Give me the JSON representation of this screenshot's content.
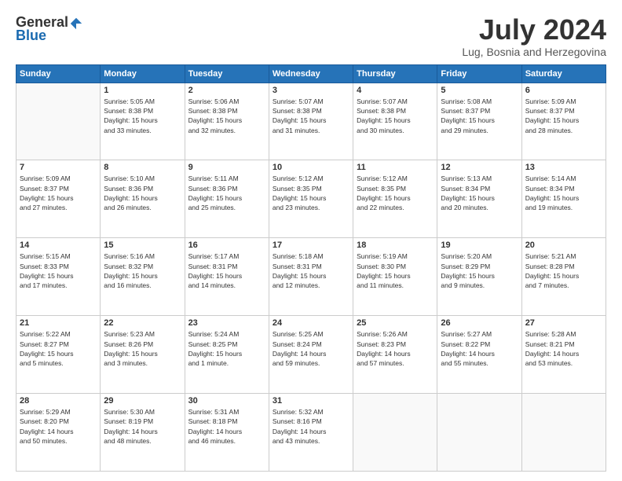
{
  "logo": {
    "general": "General",
    "blue": "Blue"
  },
  "title": "July 2024",
  "subtitle": "Lug, Bosnia and Herzegovina",
  "days_header": [
    "Sunday",
    "Monday",
    "Tuesday",
    "Wednesday",
    "Thursday",
    "Friday",
    "Saturday"
  ],
  "weeks": [
    [
      {
        "num": "",
        "info": ""
      },
      {
        "num": "1",
        "info": "Sunrise: 5:05 AM\nSunset: 8:38 PM\nDaylight: 15 hours\nand 33 minutes."
      },
      {
        "num": "2",
        "info": "Sunrise: 5:06 AM\nSunset: 8:38 PM\nDaylight: 15 hours\nand 32 minutes."
      },
      {
        "num": "3",
        "info": "Sunrise: 5:07 AM\nSunset: 8:38 PM\nDaylight: 15 hours\nand 31 minutes."
      },
      {
        "num": "4",
        "info": "Sunrise: 5:07 AM\nSunset: 8:38 PM\nDaylight: 15 hours\nand 30 minutes."
      },
      {
        "num": "5",
        "info": "Sunrise: 5:08 AM\nSunset: 8:37 PM\nDaylight: 15 hours\nand 29 minutes."
      },
      {
        "num": "6",
        "info": "Sunrise: 5:09 AM\nSunset: 8:37 PM\nDaylight: 15 hours\nand 28 minutes."
      }
    ],
    [
      {
        "num": "7",
        "info": "Sunrise: 5:09 AM\nSunset: 8:37 PM\nDaylight: 15 hours\nand 27 minutes."
      },
      {
        "num": "8",
        "info": "Sunrise: 5:10 AM\nSunset: 8:36 PM\nDaylight: 15 hours\nand 26 minutes."
      },
      {
        "num": "9",
        "info": "Sunrise: 5:11 AM\nSunset: 8:36 PM\nDaylight: 15 hours\nand 25 minutes."
      },
      {
        "num": "10",
        "info": "Sunrise: 5:12 AM\nSunset: 8:35 PM\nDaylight: 15 hours\nand 23 minutes."
      },
      {
        "num": "11",
        "info": "Sunrise: 5:12 AM\nSunset: 8:35 PM\nDaylight: 15 hours\nand 22 minutes."
      },
      {
        "num": "12",
        "info": "Sunrise: 5:13 AM\nSunset: 8:34 PM\nDaylight: 15 hours\nand 20 minutes."
      },
      {
        "num": "13",
        "info": "Sunrise: 5:14 AM\nSunset: 8:34 PM\nDaylight: 15 hours\nand 19 minutes."
      }
    ],
    [
      {
        "num": "14",
        "info": "Sunrise: 5:15 AM\nSunset: 8:33 PM\nDaylight: 15 hours\nand 17 minutes."
      },
      {
        "num": "15",
        "info": "Sunrise: 5:16 AM\nSunset: 8:32 PM\nDaylight: 15 hours\nand 16 minutes."
      },
      {
        "num": "16",
        "info": "Sunrise: 5:17 AM\nSunset: 8:31 PM\nDaylight: 15 hours\nand 14 minutes."
      },
      {
        "num": "17",
        "info": "Sunrise: 5:18 AM\nSunset: 8:31 PM\nDaylight: 15 hours\nand 12 minutes."
      },
      {
        "num": "18",
        "info": "Sunrise: 5:19 AM\nSunset: 8:30 PM\nDaylight: 15 hours\nand 11 minutes."
      },
      {
        "num": "19",
        "info": "Sunrise: 5:20 AM\nSunset: 8:29 PM\nDaylight: 15 hours\nand 9 minutes."
      },
      {
        "num": "20",
        "info": "Sunrise: 5:21 AM\nSunset: 8:28 PM\nDaylight: 15 hours\nand 7 minutes."
      }
    ],
    [
      {
        "num": "21",
        "info": "Sunrise: 5:22 AM\nSunset: 8:27 PM\nDaylight: 15 hours\nand 5 minutes."
      },
      {
        "num": "22",
        "info": "Sunrise: 5:23 AM\nSunset: 8:26 PM\nDaylight: 15 hours\nand 3 minutes."
      },
      {
        "num": "23",
        "info": "Sunrise: 5:24 AM\nSunset: 8:25 PM\nDaylight: 15 hours\nand 1 minute."
      },
      {
        "num": "24",
        "info": "Sunrise: 5:25 AM\nSunset: 8:24 PM\nDaylight: 14 hours\nand 59 minutes."
      },
      {
        "num": "25",
        "info": "Sunrise: 5:26 AM\nSunset: 8:23 PM\nDaylight: 14 hours\nand 57 minutes."
      },
      {
        "num": "26",
        "info": "Sunrise: 5:27 AM\nSunset: 8:22 PM\nDaylight: 14 hours\nand 55 minutes."
      },
      {
        "num": "27",
        "info": "Sunrise: 5:28 AM\nSunset: 8:21 PM\nDaylight: 14 hours\nand 53 minutes."
      }
    ],
    [
      {
        "num": "28",
        "info": "Sunrise: 5:29 AM\nSunset: 8:20 PM\nDaylight: 14 hours\nand 50 minutes."
      },
      {
        "num": "29",
        "info": "Sunrise: 5:30 AM\nSunset: 8:19 PM\nDaylight: 14 hours\nand 48 minutes."
      },
      {
        "num": "30",
        "info": "Sunrise: 5:31 AM\nSunset: 8:18 PM\nDaylight: 14 hours\nand 46 minutes."
      },
      {
        "num": "31",
        "info": "Sunrise: 5:32 AM\nSunset: 8:16 PM\nDaylight: 14 hours\nand 43 minutes."
      },
      {
        "num": "",
        "info": ""
      },
      {
        "num": "",
        "info": ""
      },
      {
        "num": "",
        "info": ""
      }
    ]
  ]
}
